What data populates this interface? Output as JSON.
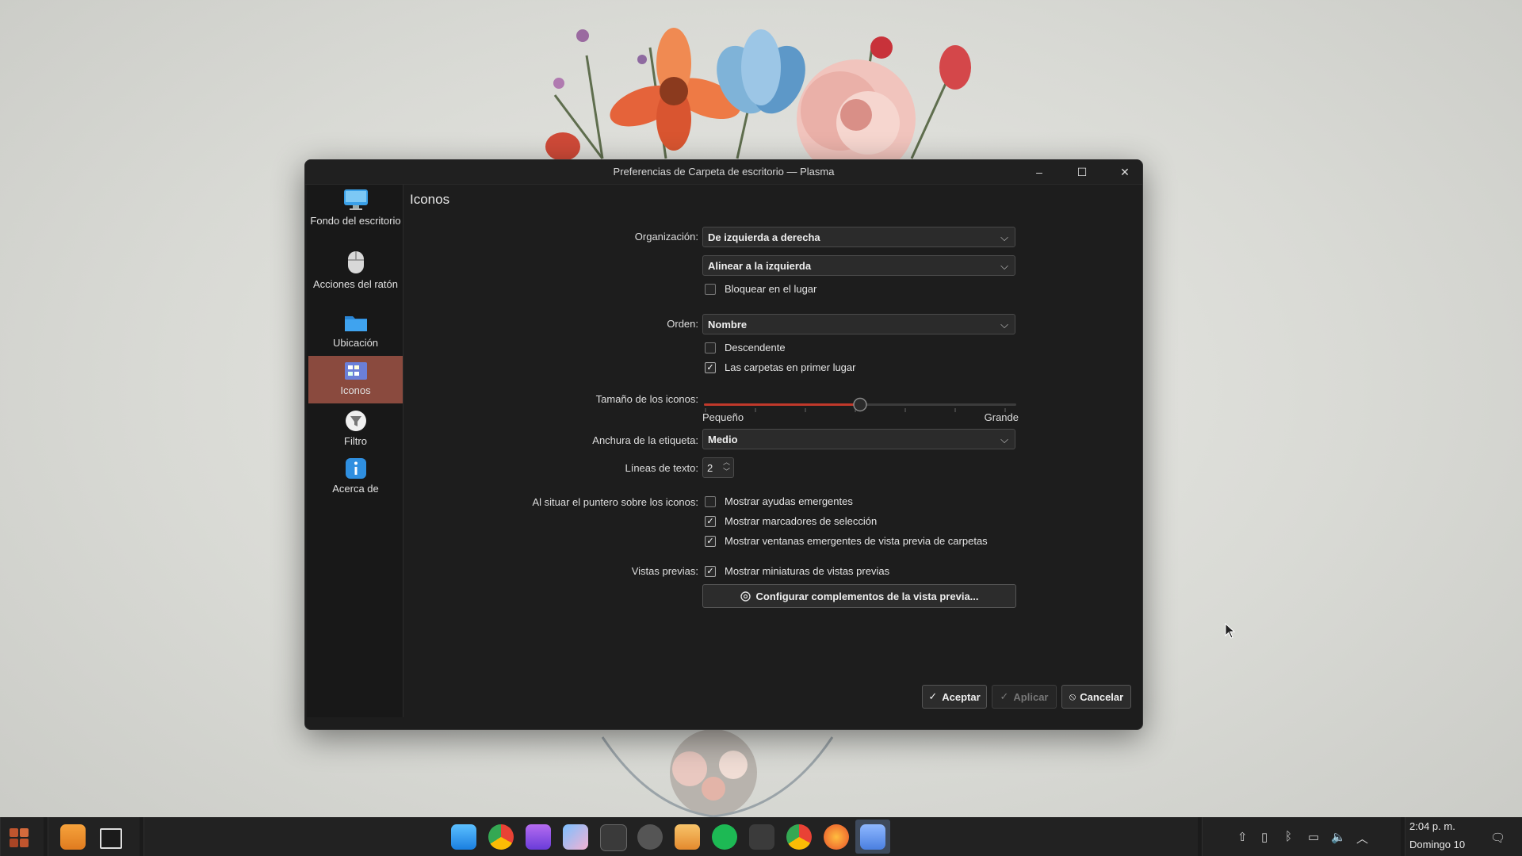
{
  "window": {
    "title": "Preferencias de Carpeta de escritorio — Plasma"
  },
  "titlebar_buttons": {
    "minimize": "–",
    "maximize": "☐",
    "close": "✕"
  },
  "sidebar": {
    "items": [
      {
        "label": "Fondo del escritorio",
        "icon": "monitor-icon"
      },
      {
        "label": "Acciones del ratón",
        "icon": "mouse-icon"
      },
      {
        "label": "Ubicación",
        "icon": "folder-icon"
      },
      {
        "label": "Iconos",
        "icon": "icons-view-icon",
        "active": true
      },
      {
        "label": "Filtro",
        "icon": "filter-icon"
      },
      {
        "label": "Acerca de",
        "icon": "info-icon"
      }
    ]
  },
  "page": {
    "title": "Iconos"
  },
  "form": {
    "organizacion_label": "Organización:",
    "organizacion_value": "De izquierda a derecha",
    "alinear_value": "Alinear a la izquierda",
    "bloquear_label": "Bloquear en el lugar",
    "bloquear_checked": false,
    "orden_label": "Orden:",
    "orden_value": "Nombre",
    "descendente_label": "Descendente",
    "descendente_checked": false,
    "carpetas_label": "Las carpetas en primer lugar",
    "carpetas_checked": true,
    "tamano_label": "Tamaño de los iconos:",
    "tamano_level": 0.5,
    "tamano_min": "Pequeño",
    "tamano_max": "Grande",
    "anchura_label": "Anchura de la etiqueta:",
    "anchura_value": "Medio",
    "lineas_label": "Líneas de texto:",
    "lineas_value": "2",
    "puntero_label": "Al situar el puntero sobre los iconos:",
    "ayudas_label": "Mostrar ayudas emergentes",
    "ayudas_checked": false,
    "marcadores_label": "Mostrar marcadores de selección",
    "marcadores_checked": true,
    "ventanas_label": "Mostrar ventanas emergentes de vista previa de carpetas",
    "ventanas_checked": true,
    "vistas_label": "Vistas previas:",
    "miniaturas_label": "Mostrar miniaturas de vistas previas",
    "miniaturas_checked": true,
    "configurar_label": "Configurar complementos de la vista previa..."
  },
  "buttons": {
    "aceptar": "Aceptar",
    "aplicar": "Aplicar",
    "cancelar": "Cancelar"
  },
  "taskbar": {
    "apps": [
      "start-menu-icon",
      "file-manager-icon",
      "desktop-icon",
      "finder-icon",
      "chrome-icon",
      "store-icon",
      "photos-icon",
      "terminal-icon",
      "settings-icon",
      "image-viewer-icon",
      "spotify-icon",
      "inkscape-icon",
      "chrome-dev-icon",
      "firefox-icon",
      "remote-desktop-icon"
    ],
    "clock_time": "2:04 p. m.",
    "clock_date": "Domingo 10"
  },
  "colors": {
    "accent": "#8a4a3e",
    "window_bg": "#1d1d1d",
    "slider_fill": "#c0392b"
  }
}
